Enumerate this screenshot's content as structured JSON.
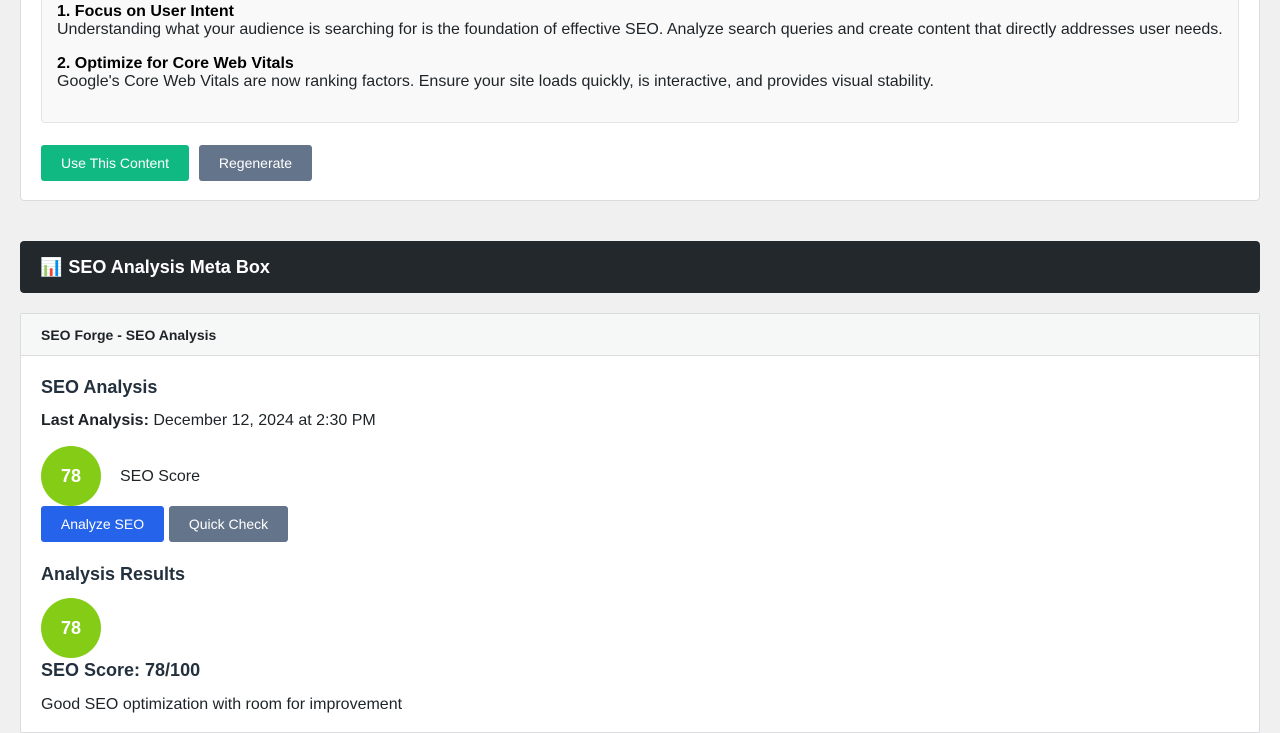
{
  "generated_content": {
    "points": [
      {
        "title": "1. Focus on User Intent",
        "text": "Understanding what your audience is searching for is the foundation of effective SEO. Analyze search queries and create content that directly addresses user needs."
      },
      {
        "title": "2. Optimize for Core Web Vitals",
        "text": "Google's Core Web Vitals are now ranking factors. Ensure your site loads quickly, is interactive, and provides visual stability."
      }
    ],
    "use_button": "Use This Content",
    "regenerate_button": "Regenerate"
  },
  "section": {
    "icon": "📊",
    "title": "SEO Analysis Meta Box"
  },
  "meta_box": {
    "header_title": "SEO Forge - SEO Analysis",
    "heading": "SEO Analysis",
    "last_analysis_label": "Last Analysis:",
    "last_analysis_value": "December 12, 2024 at 2:30 PM",
    "score": "78",
    "score_label": "SEO Score",
    "analyze_button": "Analyze SEO",
    "quick_check_button": "Quick Check",
    "results_heading": "Analysis Results",
    "results_score": "78",
    "results_score_text": "SEO Score: 78/100",
    "results_summary": "Good SEO optimization with room for improvement",
    "score_color": "#84cc16"
  }
}
